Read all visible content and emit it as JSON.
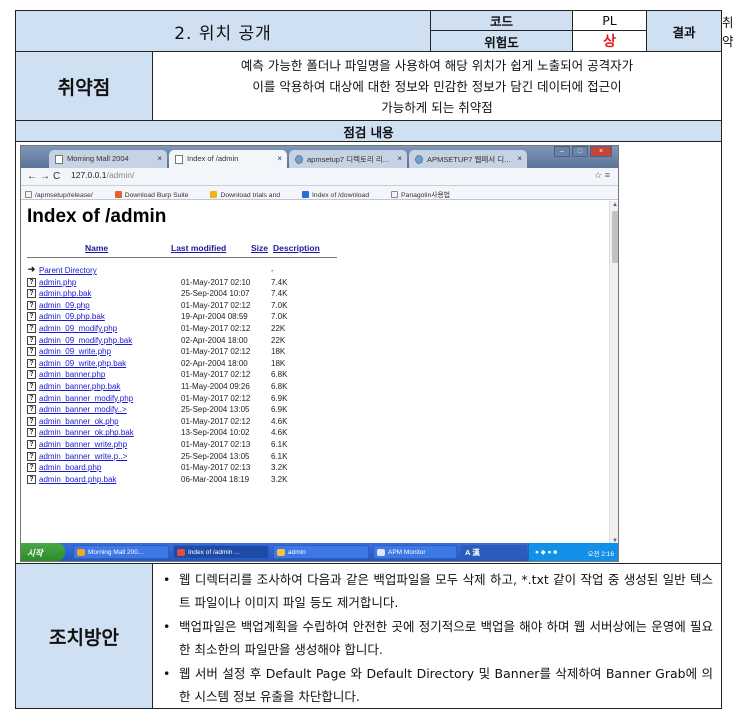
{
  "header": {
    "title": "2. 위치 공개",
    "code_label": "코드",
    "code_value": "PL",
    "risk_label": "위험도",
    "risk_value": "상",
    "result_label": "결과",
    "result_value": "취약"
  },
  "vulnerability": {
    "label": "취약점",
    "lines": [
      "예측 가능한 폴더나 파일명을 사용하여 해당 위치가 쉽게 노출되어 공격자가",
      "이를 악용하여 대상에 대한 정보와 민감한 정보가 담긴 데이터에 접근이",
      "가능하게 되는 취약점"
    ]
  },
  "inspection": {
    "title": "점검 내용"
  },
  "browser": {
    "tabs": [
      {
        "label": "Morning Mall 2004",
        "active": false
      },
      {
        "label": "Index of /admin",
        "active": true
      },
      {
        "label": "apmsetup7 디렉토리 리...",
        "active": false
      },
      {
        "label": "APMSETUP7 웹페서 디...",
        "active": false
      }
    ],
    "url_host": "127.0.0.1",
    "url_path": "/admin/",
    "bookmarks": [
      "/apmsetup/release/",
      "Download Burp Suite",
      "Download trials and",
      "Index of /download",
      "Panagolin사용법"
    ],
    "page_heading": "Index of /admin",
    "columns": {
      "name": "Name",
      "modified": "Last modified",
      "size": "Size",
      "description": "Description"
    },
    "files": [
      {
        "name": "Parent Directory",
        "date": "",
        "size": "-",
        "icon": "back-arrow-icon"
      },
      {
        "name": "admin.php",
        "date": "01-May-2017 02:10",
        "size": "7.4K"
      },
      {
        "name": "admin.php.bak",
        "date": "25-Sep-2004 10:07",
        "size": "7.4K"
      },
      {
        "name": "admin_09.php",
        "date": "01-May-2017 02:12",
        "size": "7.0K"
      },
      {
        "name": "admin_09.php.bak",
        "date": "19-Apr-2004 08:59",
        "size": "7.0K"
      },
      {
        "name": "admin_09_modify.php",
        "date": "01-May-2017 02:12",
        "size": " 22K"
      },
      {
        "name": "admin_09_modify.php.bak",
        "date": "02-Apr-2004 18:00",
        "size": " 22K"
      },
      {
        "name": "admin_09_write.php",
        "date": "01-May-2017 02:12",
        "size": " 18K"
      },
      {
        "name": "admin_09_write.php.bak",
        "date": "02-Apr-2004 18:00",
        "size": " 18K"
      },
      {
        "name": "admin_banner.php",
        "date": "01-May-2017 02:12",
        "size": "6.8K"
      },
      {
        "name": "admin_banner.php.bak",
        "date": "11-May-2004 09:26",
        "size": "6.8K"
      },
      {
        "name": "admin_banner_modify.php",
        "date": "01-May-2017 02:12",
        "size": "6.9K"
      },
      {
        "name": "admin_banner_modify..>",
        "date": "25-Sep-2004 13:05",
        "size": "6.9K"
      },
      {
        "name": "admin_banner_ok.php",
        "date": "01-May-2017 02:12",
        "size": "4.6K"
      },
      {
        "name": "admin_banner_ok.php.bak",
        "date": "13-Sep-2004 10:02",
        "size": "4.6K"
      },
      {
        "name": "admin_banner_write.php",
        "date": "01-May-2017 02:13",
        "size": "6.1K"
      },
      {
        "name": "admin_banner_write.p..>",
        "date": "25-Sep-2004 13:05",
        "size": "6.1K"
      },
      {
        "name": "admin_board.php",
        "date": "01-May-2017 02:13",
        "size": "3.2K"
      },
      {
        "name": "admin_board.php.bak",
        "date": "06-Mar-2004 18:19",
        "size": "3.2K"
      }
    ],
    "taskbar": {
      "start": "시작",
      "tasks": [
        "Morning Mall 200...",
        "Index of /admin ...",
        "admin",
        "APM Monitor"
      ],
      "lang": "A 漢",
      "clock": "오전 2:16"
    }
  },
  "remediation": {
    "label": "조치방안",
    "bullets": [
      "웹 디렉터리를 조사하여 다음과 같은 백업파일을 모두 삭제 하고, *.txt 같이 작업 중 생성된 일반 텍스트 파일이나 이미지 파일 등도 제거합니다.",
      "백업파일은 백업계획을 수립하여 안전한 곳에 정기적으로 백업을 해야 하며 웹 서버상에는 운영에 필요한 최소한의 파일만을 생성해야 합니다.",
      "웹 서버 설정 후 Default Page 와 Default Directory 및 Banner를 삭제하여 Banner Grab에 의한 시스템 정보 유출을 차단합니다."
    ]
  },
  "colors": {
    "header_bg": "#cfe0f3",
    "risk_red": "#e8171f",
    "link_blue": "#1a1ad0"
  }
}
